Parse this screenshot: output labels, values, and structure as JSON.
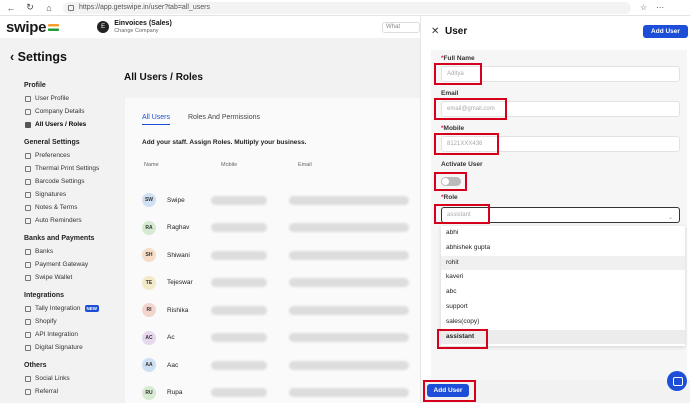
{
  "browser": {
    "url": "https://app.getswipe.in/user?tab=all_users",
    "back_glyph": "←",
    "refresh_glyph": "↻",
    "home_glyph": "⌂"
  },
  "app": {
    "logo": "swipe",
    "company_name": "Einvoices (Sales)",
    "company_action": "Change Company",
    "company_initial": "E",
    "search_stub": "What"
  },
  "sidebar": {
    "title": "Settings",
    "back_glyph": "‹",
    "sections": [
      {
        "title": "Profile",
        "items": [
          "User Profile",
          "Company Details",
          "All Users / Roles"
        ]
      },
      {
        "title": "General Settings",
        "items": [
          "Preferences",
          "Thermal Print Settings",
          "Barcode Settings",
          "Signatures",
          "Notes & Terms",
          "Auto Reminders"
        ]
      },
      {
        "title": "Banks and Payments",
        "items": [
          "Banks",
          "Payment Gateway",
          "Swipe Wallet"
        ]
      },
      {
        "title": "Integrations",
        "items": [
          "Tally Integration",
          "Shopify",
          "API Integration",
          "Digital Signature"
        ]
      },
      {
        "title": "Others",
        "items": [
          "Social Links",
          "Referral"
        ]
      }
    ],
    "new_badge": "NEW"
  },
  "main": {
    "title": "All Users / Roles",
    "tabs": [
      "All Users",
      "Roles And Permissions"
    ],
    "tagline": "Add your staff. Assign Roles. Multiply your business.",
    "columns": [
      "Name",
      "Mobile",
      "Email"
    ],
    "users": [
      {
        "initials": "SW",
        "name": "Swipe",
        "color": "#cfe0f3"
      },
      {
        "initials": "RA",
        "name": "Raghav",
        "color": "#d6ead2"
      },
      {
        "initials": "SH",
        "name": "Shiwani",
        "color": "#f6ddc8"
      },
      {
        "initials": "TE",
        "name": "Tejeswar",
        "color": "#f2e9c9"
      },
      {
        "initials": "RI",
        "name": "Rishika",
        "color": "#f2d6cd"
      },
      {
        "initials": "AC",
        "name": "Ac",
        "color": "#e7d7ef"
      },
      {
        "initials": "AA",
        "name": "Aac",
        "color": "#cfe0f3"
      },
      {
        "initials": "RU",
        "name": "Rupa",
        "color": "#d6ead2"
      }
    ]
  },
  "drawer": {
    "title": "User",
    "close_glyph": "✕",
    "add_button": "Add User",
    "fields": {
      "full_name_label": "Full Name",
      "full_name_placeholder": "Aditya",
      "email_label": "Email",
      "email_placeholder": "email@gmail.com",
      "mobile_label": "Mobile",
      "mobile_placeholder": "8121XXX436",
      "activate_label": "Activate User",
      "role_label": "Role",
      "role_value": "assistant"
    },
    "required_mark": "*",
    "role_options": [
      "abhi",
      "abhishek gupta",
      "rohit",
      "kaveri",
      "abc",
      "support",
      "sales(copy)",
      "assistant"
    ],
    "footer_button": "Add User"
  }
}
